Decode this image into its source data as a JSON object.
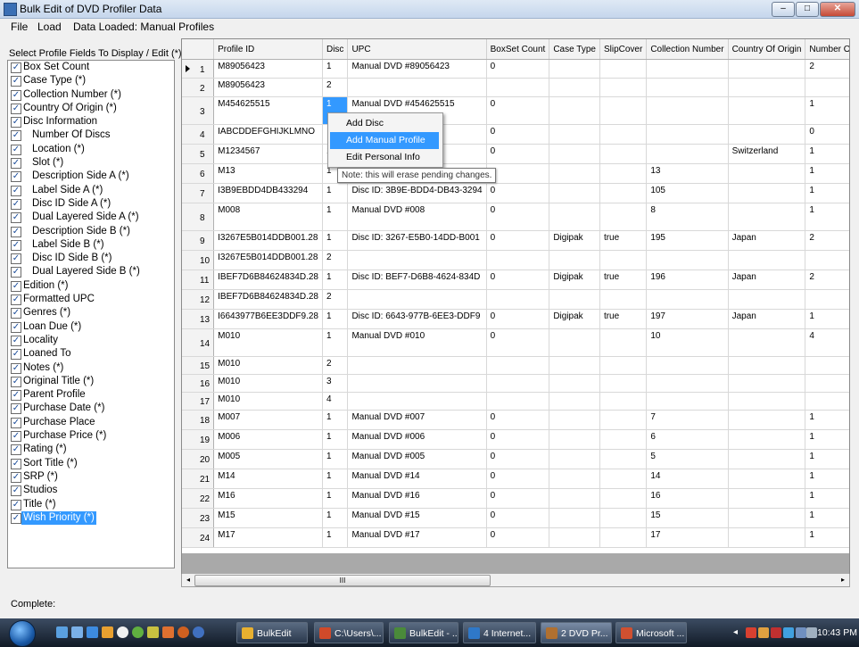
{
  "window": {
    "title": "Bulk Edit of DVD Profiler Data",
    "btn_min": "–",
    "btn_max": "□",
    "btn_close": "✕"
  },
  "menu": {
    "file": "File",
    "load": "Load",
    "data_loaded": "Data Loaded: Manual Profiles"
  },
  "left_panel": {
    "label": "Select Profile Fields To Display / Edit (*)",
    "fields": [
      {
        "label": "Box Set Count",
        "checked": true,
        "indent": 0
      },
      {
        "label": "Case Type (*)",
        "checked": true,
        "indent": 0
      },
      {
        "label": "Collection Number (*)",
        "checked": true,
        "indent": 0
      },
      {
        "label": "Country Of Origin (*)",
        "checked": true,
        "indent": 0
      },
      {
        "label": "Disc Information",
        "checked": true,
        "indent": 0
      },
      {
        "label": "Number Of Discs",
        "checked": true,
        "indent": 1
      },
      {
        "label": "Location (*)",
        "checked": true,
        "indent": 1
      },
      {
        "label": "Slot (*)",
        "checked": true,
        "indent": 1
      },
      {
        "label": "Description Side A (*)",
        "checked": true,
        "indent": 1
      },
      {
        "label": "Label Side A (*)",
        "checked": true,
        "indent": 1
      },
      {
        "label": "Disc ID Side A (*)",
        "checked": true,
        "indent": 1
      },
      {
        "label": "Dual Layered Side A (*)",
        "checked": true,
        "indent": 1
      },
      {
        "label": "Description Side B (*)",
        "checked": true,
        "indent": 1
      },
      {
        "label": "Label Side B (*)",
        "checked": true,
        "indent": 1
      },
      {
        "label": "Disc ID Side B (*)",
        "checked": true,
        "indent": 1
      },
      {
        "label": "Dual Layered Side B (*)",
        "checked": true,
        "indent": 1
      },
      {
        "label": "Edition (*)",
        "checked": true,
        "indent": 0
      },
      {
        "label": "Formatted UPC",
        "checked": true,
        "indent": 0
      },
      {
        "label": "Genres (*)",
        "checked": true,
        "indent": 0
      },
      {
        "label": "Loan Due (*)",
        "checked": true,
        "indent": 0
      },
      {
        "label": "Locality",
        "checked": true,
        "indent": 0
      },
      {
        "label": "Loaned To",
        "checked": true,
        "indent": 0
      },
      {
        "label": "Notes (*)",
        "checked": true,
        "indent": 0
      },
      {
        "label": "Original Title (*)",
        "checked": true,
        "indent": 0
      },
      {
        "label": "Parent Profile",
        "checked": true,
        "indent": 0
      },
      {
        "label": "Purchase Date (*)",
        "checked": true,
        "indent": 0
      },
      {
        "label": "Purchase Place",
        "checked": true,
        "indent": 0
      },
      {
        "label": "Purchase Price (*)",
        "checked": true,
        "indent": 0
      },
      {
        "label": "Rating (*)",
        "checked": true,
        "indent": 0
      },
      {
        "label": "Sort Title (*)",
        "checked": true,
        "indent": 0
      },
      {
        "label": "SRP (*)",
        "checked": true,
        "indent": 0
      },
      {
        "label": "Studios",
        "checked": true,
        "indent": 0
      },
      {
        "label": "Title (*)",
        "checked": true,
        "indent": 0
      },
      {
        "label": "Wish Priority (*)",
        "checked": true,
        "indent": 0,
        "selected": true
      }
    ]
  },
  "grid": {
    "columns": [
      "Profile ID",
      "Disc",
      "UPC",
      "BoxSet Count",
      "Case Type",
      "SlipCover",
      "Collection Number",
      "Country Of Origin",
      "Number Of Discs"
    ],
    "rows": [
      {
        "n": "1",
        "c": [
          "M89056423",
          "1",
          "Manual DVD #89056423",
          "0",
          "",
          "",
          "",
          "",
          "2"
        ]
      },
      {
        "n": "2",
        "c": [
          "M89056423",
          "2",
          "",
          "",
          "",
          "",
          "",
          "",
          ""
        ]
      },
      {
        "n": "3",
        "c": [
          "M454625515",
          "1",
          "Manual DVD #454625515",
          "0",
          "",
          "",
          "",
          "",
          "1"
        ]
      },
      {
        "n": "4",
        "c": [
          "IABCDDEFGHIJKLMNO",
          "",
          "LMNO",
          "0",
          "",
          "",
          "",
          "",
          "0"
        ]
      },
      {
        "n": "5",
        "c": [
          "M1234567",
          "1",
          "",
          "0",
          "",
          "",
          "",
          "Switzerland",
          "1"
        ]
      },
      {
        "n": "6",
        "c": [
          "M13",
          "1",
          "",
          "",
          "",
          "",
          "13",
          "",
          "1"
        ]
      },
      {
        "n": "7",
        "c": [
          "I3B9EBDD4DB433294",
          "1",
          "Disc ID: 3B9E-BDD4-DB43-3294",
          "0",
          "",
          "",
          "105",
          "",
          "1"
        ]
      },
      {
        "n": "8",
        "c": [
          "M008",
          "1",
          "Manual DVD #008",
          "0",
          "",
          "",
          "8",
          "",
          "1"
        ]
      },
      {
        "n": "9",
        "c": [
          "I3267E5B014DDB001.28",
          "1",
          "Disc ID: 3267-E5B0-14DD-B001",
          "0",
          "Digipak",
          "true",
          "195",
          "Japan",
          "2"
        ]
      },
      {
        "n": "10",
        "c": [
          "I3267E5B014DDB001.28",
          "2",
          "",
          "",
          "",
          "",
          "",
          "",
          ""
        ]
      },
      {
        "n": "11",
        "c": [
          "IBEF7D6B84624834D.28",
          "1",
          "Disc ID: BEF7-D6B8-4624-834D",
          "0",
          "Digipak",
          "true",
          "196",
          "Japan",
          "2"
        ]
      },
      {
        "n": "12",
        "c": [
          "IBEF7D6B84624834D.28",
          "2",
          "",
          "",
          "",
          "",
          "",
          "",
          ""
        ]
      },
      {
        "n": "13",
        "c": [
          "I6643977B6EE3DDF9.28",
          "1",
          "Disc ID: 6643-977B-6EE3-DDF9",
          "0",
          "Digipak",
          "true",
          "197",
          "Japan",
          "1"
        ]
      },
      {
        "n": "14",
        "c": [
          "M010",
          "1",
          "Manual DVD #010",
          "0",
          "",
          "",
          "10",
          "",
          "4"
        ]
      },
      {
        "n": "15",
        "c": [
          "M010",
          "2",
          "",
          "",
          "",
          "",
          "",
          "",
          ""
        ]
      },
      {
        "n": "16",
        "c": [
          "M010",
          "3",
          "",
          "",
          "",
          "",
          "",
          "",
          ""
        ]
      },
      {
        "n": "17",
        "c": [
          "M010",
          "4",
          "",
          "",
          "",
          "",
          "",
          "",
          ""
        ]
      },
      {
        "n": "18",
        "c": [
          "M007",
          "1",
          "Manual DVD #007",
          "0",
          "",
          "",
          "7",
          "",
          "1"
        ]
      },
      {
        "n": "19",
        "c": [
          "M006",
          "1",
          "Manual DVD #006",
          "0",
          "",
          "",
          "6",
          "",
          "1"
        ]
      },
      {
        "n": "20",
        "c": [
          "M005",
          "1",
          "Manual DVD #005",
          "0",
          "",
          "",
          "5",
          "",
          "1"
        ]
      },
      {
        "n": "21",
        "c": [
          "M14",
          "1",
          "Manual DVD #14",
          "0",
          "",
          "",
          "14",
          "",
          "1"
        ]
      },
      {
        "n": "22",
        "c": [
          "M16",
          "1",
          "Manual DVD #16",
          "0",
          "",
          "",
          "16",
          "",
          "1"
        ]
      },
      {
        "n": "23",
        "c": [
          "M15",
          "1",
          "Manual DVD #15",
          "0",
          "",
          "",
          "15",
          "",
          "1"
        ]
      },
      {
        "n": "24",
        "c": [
          "M17",
          "1",
          "Manual DVD #17",
          "0",
          "",
          "",
          "17",
          "",
          "1"
        ]
      }
    ],
    "current_row": 0,
    "selected_cell": {
      "row": 2,
      "col": 1
    },
    "scroll_left": "◂",
    "scroll_right": "▸",
    "scroll_grip": "III"
  },
  "context_menu": {
    "items": [
      "Add Disc",
      "Add Manual Profile",
      "Edit Personal Info"
    ],
    "highlighted": 1
  },
  "tooltip": "Note: this will erase pending changes.",
  "status": "Complete:",
  "taskbar": {
    "tasks": [
      {
        "label": "BulkEdit",
        "color": "#e8b030"
      },
      {
        "label": "C:\\Users\\...",
        "color": "#d04a2a"
      },
      {
        "label": "BulkEdit - ...",
        "color": "#4a8a3a"
      },
      {
        "label": "4 Internet...",
        "color": "#2f78c8"
      },
      {
        "label": "2 DVD Pr...",
        "color": "#b07030",
        "active": true
      },
      {
        "label": "Microsoft ...",
        "color": "#d05030"
      }
    ],
    "clock": "10:43 PM"
  }
}
